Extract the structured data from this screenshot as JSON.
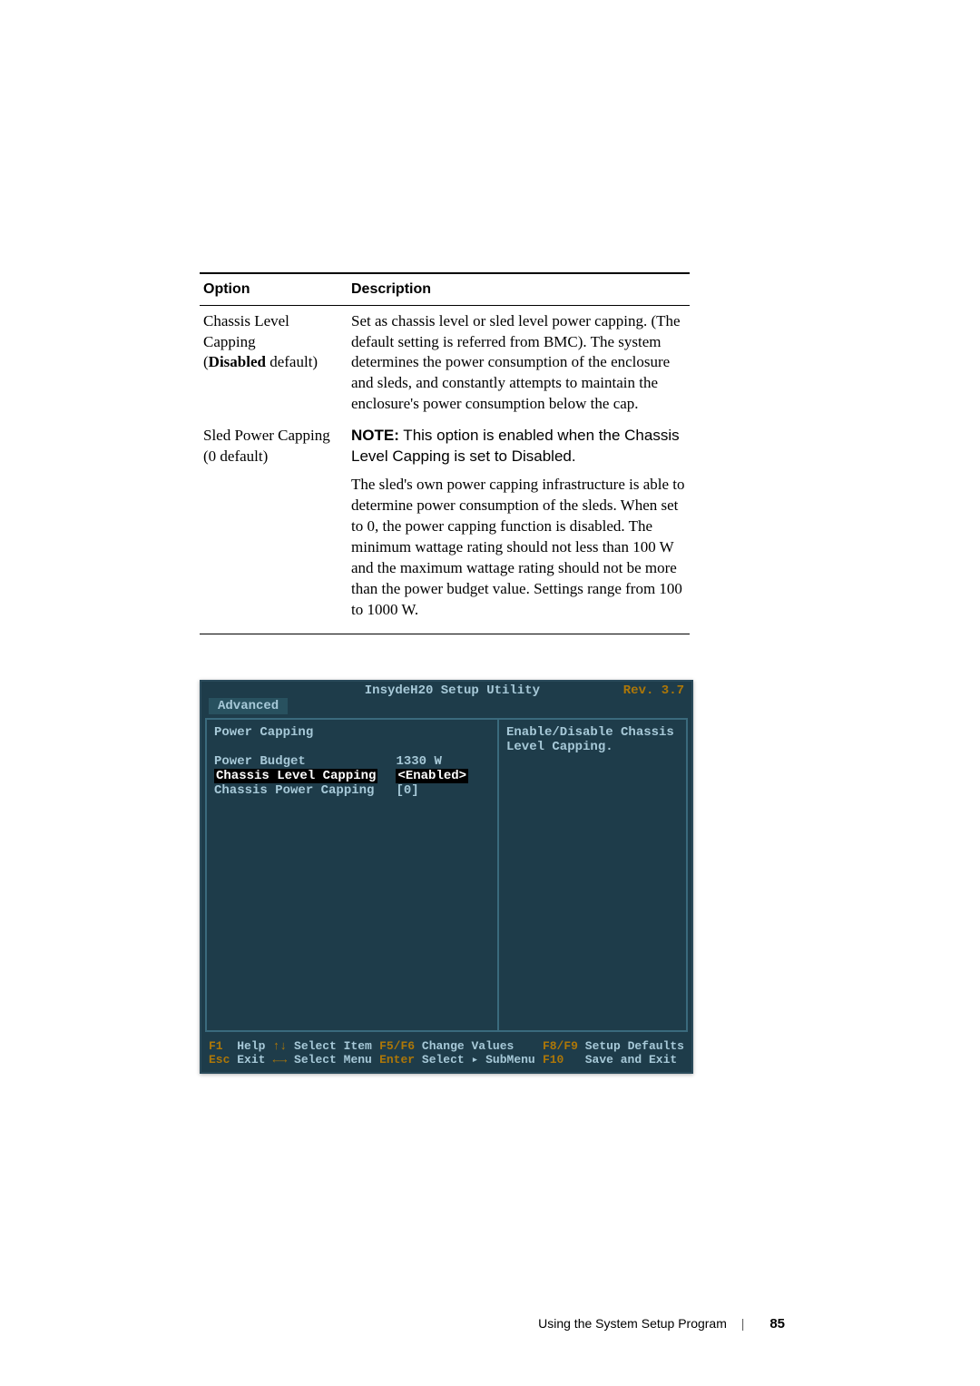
{
  "table": {
    "headers": {
      "option": "Option",
      "description": "Description"
    },
    "rows": [
      {
        "opt_name": "Chassis Level Capping",
        "opt_paren_open": "(",
        "opt_default_bold": "Disabled",
        "opt_default_tail": " default)",
        "desc": "Set as chassis level or sled level power capping. (The default setting is referred from BMC). The system determines the power consumption of the enclosure and sleds, and constantly attempts to maintain the enclosure's power consumption below the cap."
      },
      {
        "opt_name": "Sled Power Capping",
        "opt_sub": "(0 default)",
        "note_prefix": "NOTE:",
        "note_body": " This option is enabled when the Chassis Level Capping is set to Disabled.",
        "desc": "The sled's own power capping infrastructure is able to determine power consumption of the sleds. When set to 0, the power capping function is disabled. The minimum wattage rating should not less than 100 W and the maximum wattage rating should not be more than the power budget value. Settings range from 100 to 1000 W."
      }
    ]
  },
  "screenshot": {
    "title": "InsydeH20 Setup Utility",
    "rev": "Rev. 3.7",
    "tab": "Advanced",
    "left_heading": "Power Capping",
    "items": [
      {
        "label": "Power Budget",
        "value": "1330 W"
      },
      {
        "label": "Chassis Level Capping",
        "value": "<Enabled>",
        "selected": true
      },
      {
        "label": "Chassis Power Capping",
        "value": "[0]"
      }
    ],
    "right_help1": "Enable/Disable Chassis",
    "right_help2": "Level Capping.",
    "footer": {
      "col1_l1_k": "F1",
      "col1_l1_t": "Help",
      "col1_l2_k": "Esc",
      "col1_l2_t": "Exit",
      "col2_l1_k": "↑↓",
      "col2_l1_t": "Select Item",
      "col2_l2_k": "←→",
      "col2_l2_t": "Select Menu",
      "col3_l1_k": "F5/F6",
      "col3_l1_t": "Change Values",
      "col3_l2_k": "Enter",
      "col3_l2_t": "Select ▸ SubMenu",
      "col4_l1_k": "F8/F9",
      "col4_l1_t": "Setup Defaults",
      "col4_l2_k": "F10",
      "col4_l2_t": "Save and Exit"
    }
  },
  "footer": {
    "section": "Using the System Setup Program",
    "page": "85"
  }
}
